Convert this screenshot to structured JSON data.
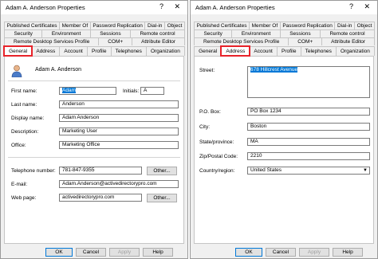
{
  "left": {
    "title": "Adam A. Anderson Properties",
    "help": "?",
    "close": "✕",
    "tabs_row1": [
      "Published Certificates",
      "Member Of",
      "Password Replication",
      "Dial-in",
      "Object"
    ],
    "tabs_row2": [
      "Security",
      "Environment",
      "Sessions",
      "Remote control"
    ],
    "tabs_row3": [
      "Remote Desktop Services Profile",
      "COM+",
      "Attribute Editor"
    ],
    "tabs_row4": [
      "General",
      "Address",
      "Account",
      "Profile",
      "Telephones",
      "Organization"
    ],
    "display_name_header": "Adam A. Anderson",
    "fields": {
      "first_name_label": "First name:",
      "first_name": "Adam",
      "initials_label": "Initials:",
      "initials": "A",
      "last_name_label": "Last name:",
      "last_name": "Anderson",
      "display_name_label": "Display name:",
      "display_name": "Adam Anderson",
      "description_label": "Description:",
      "description": "Marketing User",
      "office_label": "Office:",
      "office": "Marketing Office",
      "telephone_label": "Telephone number:",
      "telephone": "781-847-9355",
      "email_label": "E-mail:",
      "email": "Adam.Anderson@activedirectorypro.com",
      "webpage_label": "Web page:",
      "webpage": "activedirectorypro.com"
    },
    "other_button": "Other...",
    "buttons": {
      "ok": "OK",
      "cancel": "Cancel",
      "apply": "Apply",
      "help": "Help"
    }
  },
  "right": {
    "title": "Adam A. Anderson Properties",
    "help": "?",
    "close": "✕",
    "tabs_row1": [
      "Published Certificates",
      "Member Of",
      "Password Replication",
      "Dial-in",
      "Object"
    ],
    "tabs_row2": [
      "Security",
      "Environment",
      "Sessions",
      "Remote control"
    ],
    "tabs_row3": [
      "Remote Desktop Services Profile",
      "COM+",
      "Attribute Editor"
    ],
    "tabs_row4": [
      "General",
      "Address",
      "Account",
      "Profile",
      "Telephones",
      "Organization"
    ],
    "fields": {
      "street_label": "Street:",
      "street": "678 Hillcrest Avenue",
      "pobox_label": "P.O. Box:",
      "pobox": "PO Box 1234",
      "city_label": "City:",
      "city": "Boston",
      "state_label": "State/province:",
      "state": "MA",
      "zip_label": "Zip/Postal Code:",
      "zip": "2210",
      "country_label": "Country/region:",
      "country": "United States"
    },
    "buttons": {
      "ok": "OK",
      "cancel": "Cancel",
      "apply": "Apply",
      "help": "Help"
    }
  },
  "colors": {
    "highlight": "#e8232a",
    "selection": "#0078d7"
  },
  "icons": {
    "user": "user-icon",
    "dropdown": "chevron-down-icon"
  }
}
